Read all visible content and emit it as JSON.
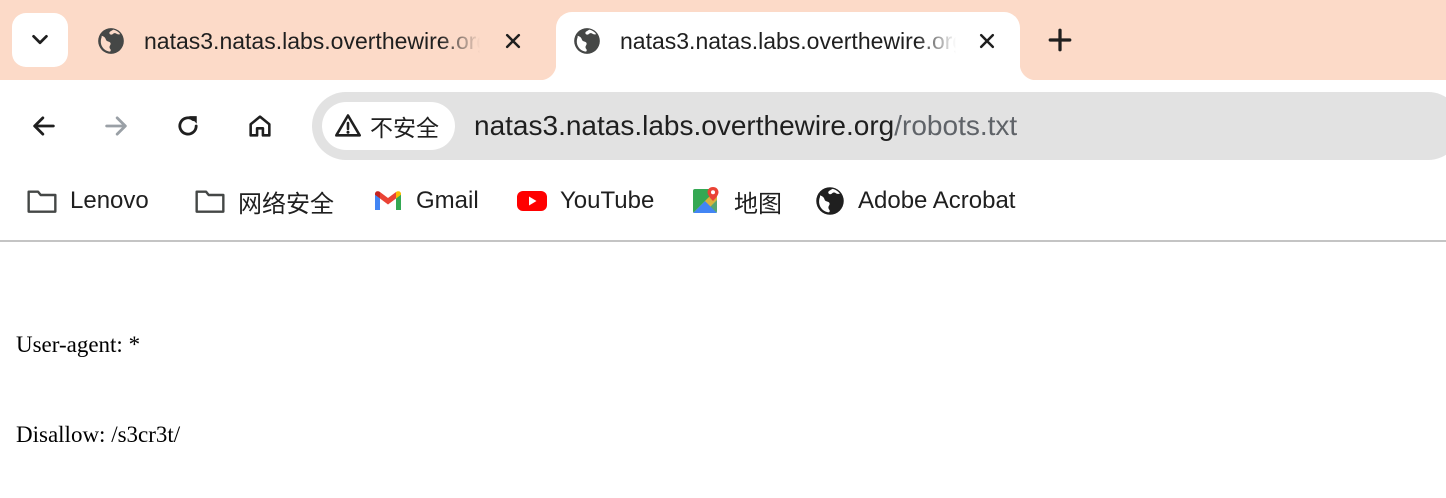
{
  "tabs": [
    {
      "title": "natas3.natas.labs.overthewire.org",
      "favicon": "globe-icon",
      "active": false
    },
    {
      "title": "natas3.natas.labs.overthewire.org",
      "favicon": "globe-icon",
      "active": true
    }
  ],
  "tab_strip": {
    "search_icon": "chevron-down-icon",
    "new_tab_icon": "plus-icon"
  },
  "toolbar": {
    "back_icon": "arrow-left-icon",
    "forward_icon": "arrow-right-icon",
    "reload_icon": "reload-icon",
    "home_icon": "home-icon"
  },
  "omnibox": {
    "security_label": "不安全",
    "security_icon": "warning-icon",
    "url_host": "natas3.natas.labs.overthewire.org",
    "url_path": "/robots.txt"
  },
  "bookmarks": [
    {
      "label": "Lenovo",
      "icon": "folder-icon"
    },
    {
      "label": "网络安全",
      "icon": "folder-icon"
    },
    {
      "label": "Gmail",
      "icon": "gmail-icon"
    },
    {
      "label": "YouTube",
      "icon": "youtube-icon"
    },
    {
      "label": "地图",
      "icon": "maps-icon"
    },
    {
      "label": "Adobe Acrobat",
      "icon": "globe-icon"
    }
  ],
  "page": {
    "lines": [
      "User-agent: *",
      "Disallow: /s3cr3t/"
    ]
  },
  "colors": {
    "tab_strip": "#fcdac8",
    "omnibox": "#e2e2e2",
    "youtube_red": "#ff0000"
  }
}
